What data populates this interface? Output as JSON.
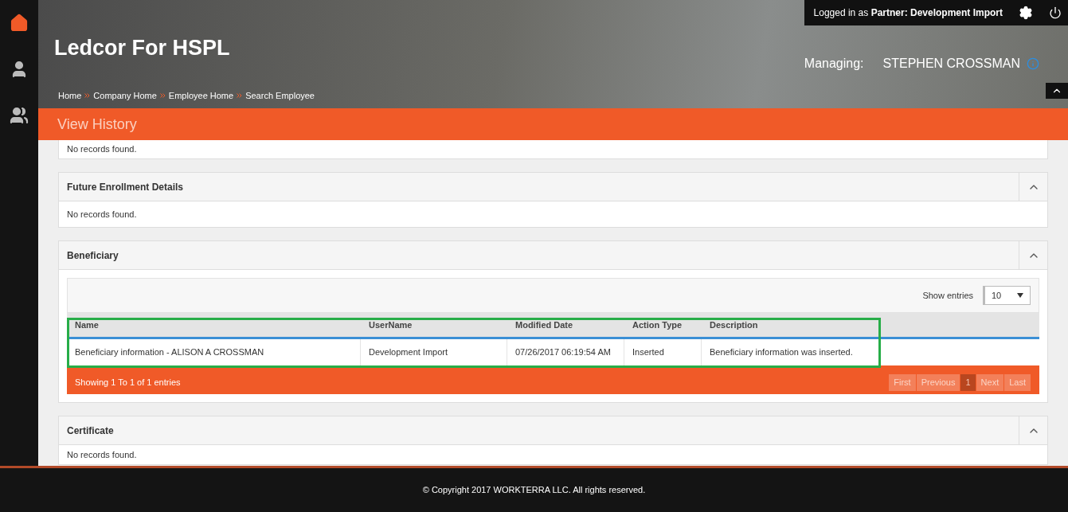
{
  "header": {
    "title": "Ledcor For HSPL",
    "breadcrumbs": [
      "Home",
      "Company Home",
      "Employee Home",
      "Search Employee"
    ],
    "login": {
      "prefix": "Logged in as",
      "role": "Partner:",
      "name": "Development Import"
    },
    "managing": {
      "label": "Managing:",
      "name": "STEPHEN CROSSMAN"
    }
  },
  "sidebar": {
    "items": [
      {
        "kind": "home",
        "selected": true
      },
      {
        "kind": "person",
        "selected": false
      },
      {
        "kind": "people",
        "selected": false
      }
    ]
  },
  "page_title": "View History",
  "top_panel": {
    "message": "No records found."
  },
  "panels": [
    {
      "title": "Future Enrollment Details",
      "message": "No records found."
    },
    {
      "title": "Beneficiary",
      "show_entries": {
        "label": "Show entries",
        "value": "10"
      },
      "table": {
        "columns": [
          "Name",
          "UserName",
          "Modified Date",
          "Action Type",
          "Description"
        ],
        "rows": [
          [
            "Beneficiary information - ALISON A CROSSMAN",
            "Development Import",
            "07/26/2017 06:19:54 AM",
            "Inserted",
            "Beneficiary information was inserted."
          ]
        ]
      },
      "info": "Showing 1 To 1 of 1 entries",
      "pages": [
        {
          "label": "First",
          "selected": false
        },
        {
          "label": "Previous",
          "selected": false
        },
        {
          "label": "1",
          "selected": true
        },
        {
          "label": "Next",
          "selected": false
        },
        {
          "label": "Last",
          "selected": false
        }
      ]
    },
    {
      "title": "Certificate",
      "message": "No records found."
    }
  ],
  "footer": {
    "copyright": "© Copyright 2017 WORKTERRA LLC. All rights reserved."
  }
}
